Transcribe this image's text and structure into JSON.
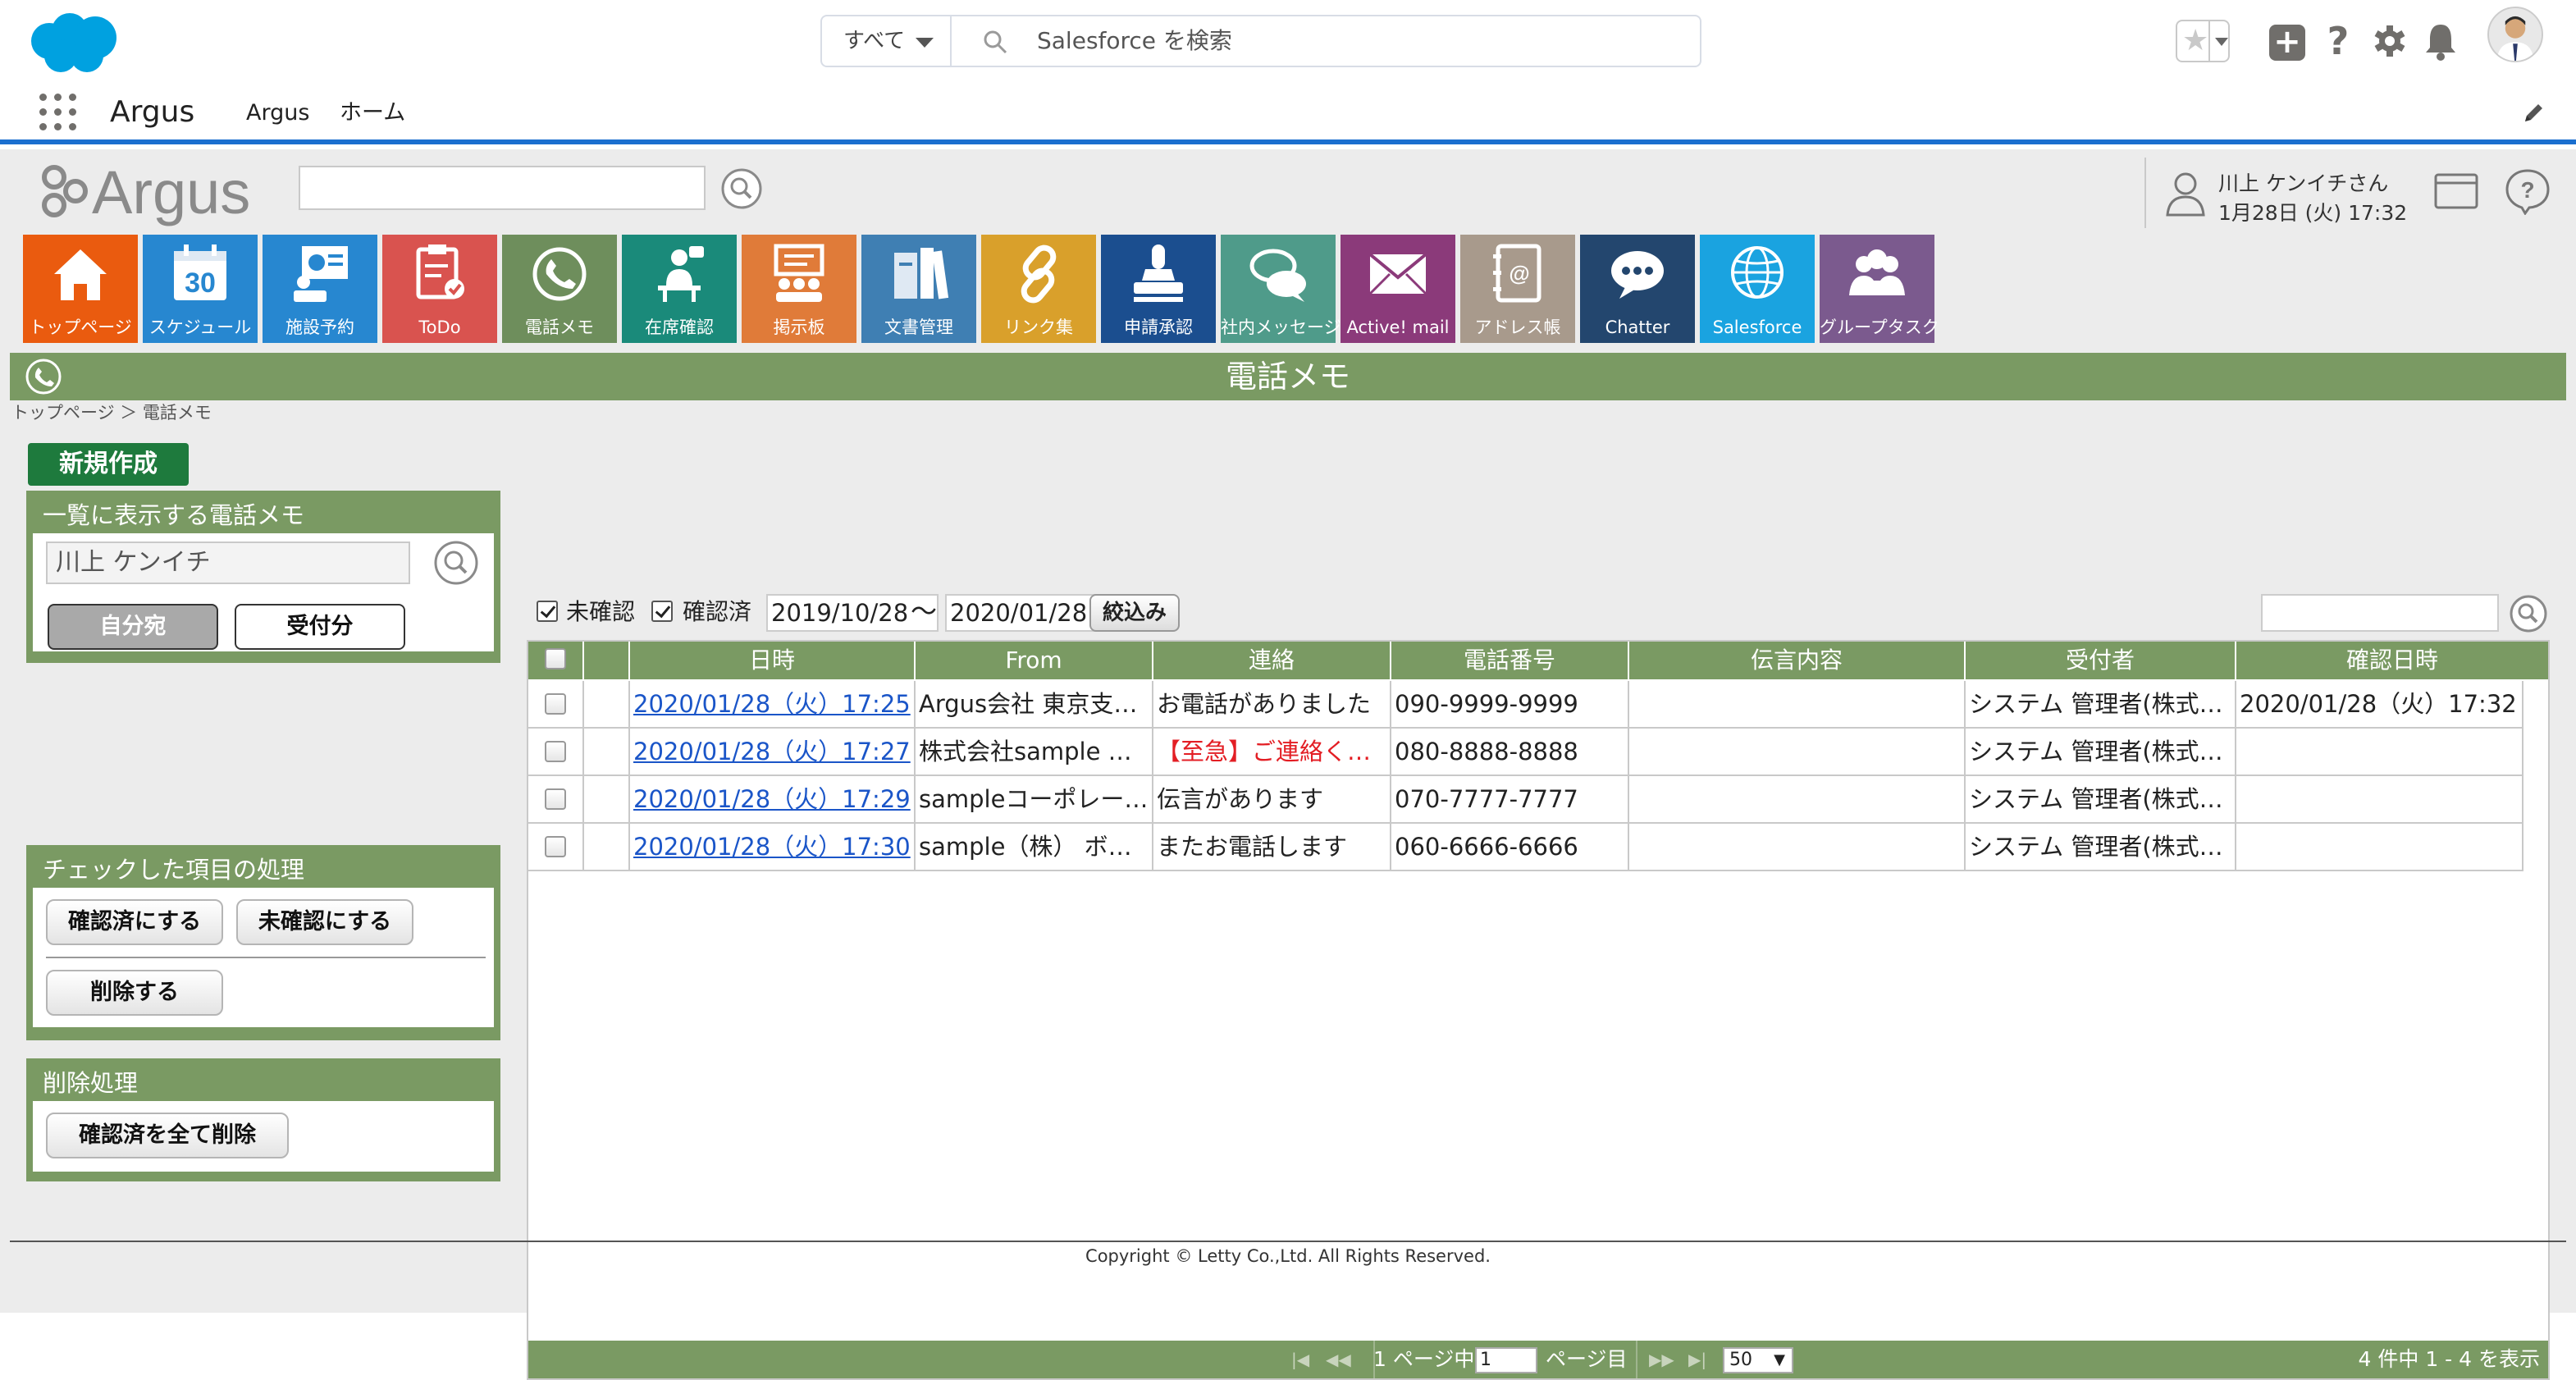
{
  "sf": {
    "search_scope": "すべて",
    "search_placeholder": "Salesforce を検索",
    "app_name": "Argus",
    "nav": [
      "Argus",
      "ホーム"
    ]
  },
  "argus": {
    "logo_text": "Argus",
    "user_name": "川上 ケンイチさん",
    "user_date": "1月28日 (火) 17:32"
  },
  "tiles": [
    {
      "label": "トップページ",
      "color": "#ea5b0f",
      "icon": "home-icon"
    },
    {
      "label": "スケジュール",
      "color": "#2787d0",
      "icon": "calendar-icon",
      "calendar_day": "30"
    },
    {
      "label": "施設予約",
      "color": "#2787d0",
      "icon": "facility-icon"
    },
    {
      "label": "ToDo",
      "color": "#d9534f",
      "icon": "todo-icon"
    },
    {
      "label": "電話メモ",
      "color": "#6e8e5c",
      "icon": "phone-icon"
    },
    {
      "label": "在席確認",
      "color": "#1a8a7a",
      "icon": "presence-icon"
    },
    {
      "label": "掲示板",
      "color": "#e07b39",
      "icon": "board-icon"
    },
    {
      "label": "文書管理",
      "color": "#3f7fb3",
      "icon": "document-icon"
    },
    {
      "label": "リンク集",
      "color": "#d9a02b",
      "icon": "link-icon"
    },
    {
      "label": "申請承認",
      "color": "#1b4e8f",
      "icon": "stamp-icon"
    },
    {
      "label": "社内メッセージ",
      "color": "#4f9b8a",
      "icon": "message-icon"
    },
    {
      "label": "Active! mail",
      "color": "#8b3a7a",
      "icon": "mail-icon"
    },
    {
      "label": "アドレス帳",
      "color": "#a89a8c",
      "icon": "address-book-icon"
    },
    {
      "label": "Chatter",
      "color": "#23466e",
      "icon": "chatter-icon"
    },
    {
      "label": "Salesforce",
      "color": "#1aa3e0",
      "icon": "globe-icon"
    },
    {
      "label": "グループタスク",
      "color": "#7b5a8e",
      "icon": "group-task-icon"
    }
  ],
  "page": {
    "title": "電話メモ",
    "breadcrumb": "トップページ ＞ 電話メモ",
    "new_button": "新規作成"
  },
  "panel_list": {
    "title": "一覧に表示する電話メモ",
    "name_value": "川上 ケンイチ",
    "btn_mine": "自分宛",
    "btn_received": "受付分"
  },
  "panel_checked": {
    "title": "チェックした項目の処理",
    "btn_confirm": "確認済にする",
    "btn_unconfirm": "未確認にする",
    "btn_delete": "削除する"
  },
  "panel_delete": {
    "title": "削除処理",
    "btn_delete_all": "確認済を全て削除"
  },
  "filter": {
    "unconfirmed_label": "未確認",
    "confirmed_label": "確認済",
    "date_from": "2019/10/28",
    "tilde": "～",
    "date_to": "2020/01/28",
    "button": "絞込み"
  },
  "grid": {
    "columns": [
      "日時",
      "From",
      "連絡",
      "電話番号",
      "伝言内容",
      "受付者",
      "確認日時"
    ],
    "rows": [
      {
        "status": "opened",
        "datetime": "2020/01/28（火）17:25",
        "from": "Argus会社 東京支…",
        "contact": "お電話がありました",
        "contact_urgent": false,
        "phone": "090-9999-9999",
        "message": "",
        "receiver": "システム 管理者(株式…",
        "confirmed": "2020/01/28（火）17:32"
      },
      {
        "status": "closed",
        "datetime": "2020/01/28（火）17:27",
        "from": "株式会社sample 花…",
        "contact": "【至急】ご連絡くだ…",
        "contact_urgent": true,
        "phone": "080-8888-8888",
        "message": "",
        "receiver": "システム 管理者(株式…",
        "confirmed": ""
      },
      {
        "status": "closed",
        "datetime": "2020/01/28（火）17:29",
        "from": "sampleコーポレー…",
        "contact": "伝言があります",
        "contact_urgent": false,
        "phone": "070-7777-7777",
        "message": "",
        "receiver": "システム 管理者(株式…",
        "confirmed": ""
      },
      {
        "status": "closed",
        "datetime": "2020/01/28（火）17:30",
        "from": "sample（株） ボブ様",
        "contact": "またお電話します",
        "contact_urgent": false,
        "phone": "060-6666-6666",
        "message": "",
        "receiver": "システム 管理者(株式…",
        "confirmed": ""
      }
    ]
  },
  "pager": {
    "page_of": "1 ページ中",
    "page_value": "1",
    "page_suffix": "ページ目",
    "page_size": "50",
    "summary": "4 件中 1 - 4 を表示"
  },
  "footer": {
    "copyright": "Copyright © Letty Co.,Ltd. All Rights Reserved."
  }
}
